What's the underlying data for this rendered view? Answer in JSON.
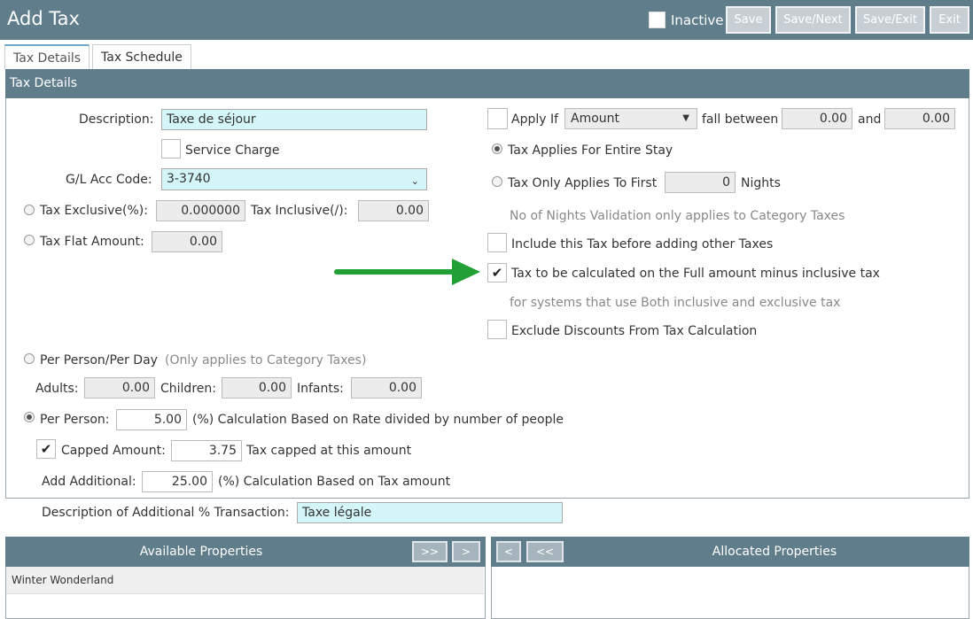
{
  "header": {
    "title": "Add Tax",
    "inactive_label": "Inactive",
    "buttons": {
      "save": "Save",
      "save_next": "Save/Next",
      "save_exit": "Save/Exit",
      "exit": "Exit"
    }
  },
  "tabs": {
    "details": "Tax Details",
    "schedule": "Tax Schedule"
  },
  "panel": {
    "title": "Tax Details"
  },
  "left": {
    "description_label": "Description:",
    "description_value": "Taxe de séjour",
    "service_charge_label": "Service Charge",
    "gl_label": "G/L Acc Code:",
    "gl_value": "3-3740",
    "tax_exclusive_label": "Tax Exclusive(%):",
    "tax_exclusive_value": "0.000000",
    "tax_inclusive_label": "Tax Inclusive(/):",
    "tax_inclusive_value": "0.00",
    "tax_flat_label": "Tax Flat Amount:",
    "tax_flat_value": "0.00",
    "per_person_day_label": "Per Person/Per Day",
    "per_person_day_note": "(Only applies to Category Taxes)",
    "adults_label": "Adults:",
    "adults_value": "0.00",
    "children_label": "Children:",
    "children_value": "0.00",
    "infants_label": "Infants:",
    "infants_value": "0.00",
    "per_person_label": "Per Person:",
    "per_person_value": "5.00",
    "per_person_note": "(%) Calculation Based on Rate divided by number of people",
    "capped_label": "Capped Amount:",
    "capped_value": "3.75",
    "capped_note": "Tax capped at this amount",
    "add_additional_label": "Add Additional:",
    "add_additional_value": "25.00",
    "add_additional_note": "(%) Calculation Based on Tax amount",
    "desc_additional_label": "Description of Additional % Transaction:",
    "desc_additional_value": "Taxe légale"
  },
  "right": {
    "apply_if_label": "Apply If",
    "apply_if_value": "Amount",
    "fall_between_label": "fall between",
    "fall_from": "0.00",
    "and_label": "and",
    "fall_to": "0.00",
    "entire_stay_label": "Tax Applies For Entire Stay",
    "first_label": "Tax Only Applies To First",
    "first_value": "0",
    "nights_label": "Nights",
    "nights_note": "No of Nights Validation only applies to Category Taxes",
    "include_before_label": "Include this Tax before adding other Taxes",
    "full_minus_label": "Tax to be calculated on the Full amount minus inclusive tax",
    "full_minus_note": "for systems that use Both inclusive and exclusive tax",
    "exclude_discounts_label": "Exclude Discounts From Tax Calculation"
  },
  "available": {
    "title": "Available Properties",
    "btn_all": ">>",
    "btn_one": ">",
    "items": [
      "Winter Wonderland"
    ]
  },
  "allocated": {
    "title": "Allocated Properties",
    "btn_one": "<",
    "btn_all": "<<"
  },
  "colors": {
    "header": "#607d8b",
    "cyan_input": "#d4f6f8",
    "arrow": "#22a036"
  },
  "icons": {
    "arrow": "green-arrow-icon",
    "check": "check-icon"
  }
}
